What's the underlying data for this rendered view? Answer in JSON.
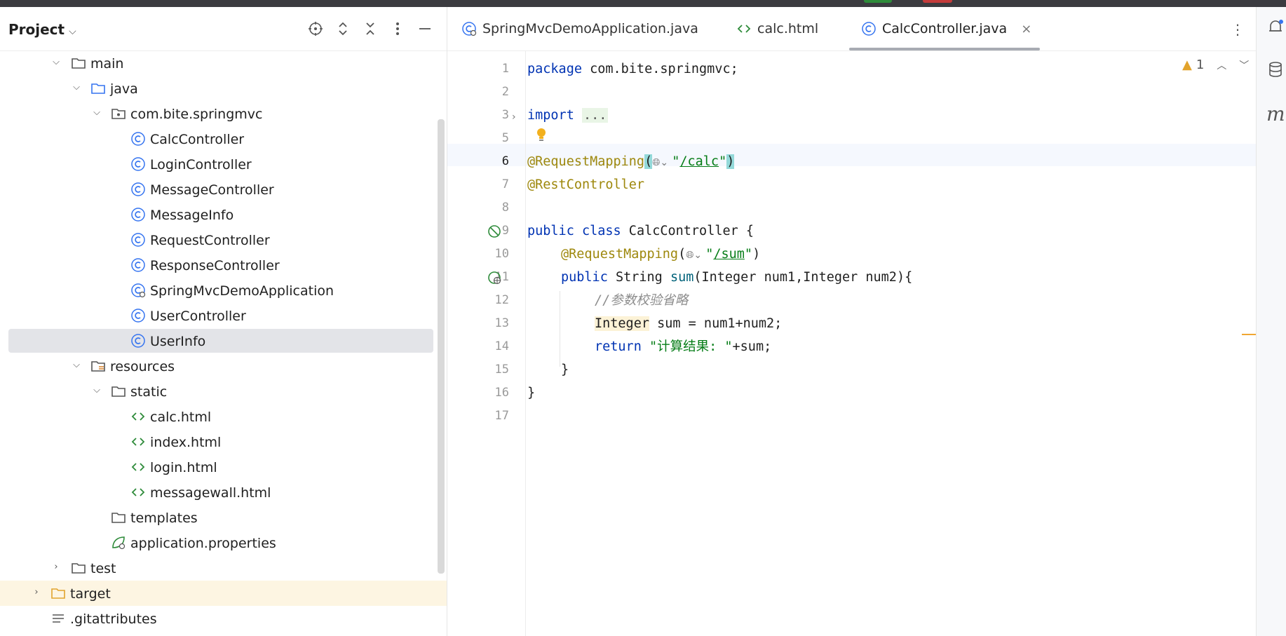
{
  "project_panel": {
    "title": "Project",
    "header_icons": [
      "locate-icon",
      "expand-all-icon",
      "collapse-all-icon",
      "more-icon",
      "minimize-icon"
    ],
    "tree": [
      {
        "label": "main",
        "type": "folder",
        "state": "expanded",
        "depth": 2
      },
      {
        "label": "java",
        "type": "source-folder",
        "state": "expanded",
        "depth": 3
      },
      {
        "label": "com.bite.springmvc",
        "type": "package",
        "state": "expanded",
        "depth": 4
      },
      {
        "label": "CalcController",
        "type": "class",
        "depth": 5
      },
      {
        "label": "LoginController",
        "type": "class",
        "depth": 5
      },
      {
        "label": "MessageController",
        "type": "class",
        "depth": 5
      },
      {
        "label": "MessageInfo",
        "type": "class",
        "depth": 5
      },
      {
        "label": "RequestController",
        "type": "class",
        "depth": 5
      },
      {
        "label": "ResponseController",
        "type": "class",
        "depth": 5
      },
      {
        "label": "SpringMvcDemoApplication",
        "type": "spring-app-class",
        "depth": 5
      },
      {
        "label": "UserController",
        "type": "class",
        "depth": 5
      },
      {
        "label": "UserInfo",
        "type": "class",
        "depth": 5,
        "selected": true
      },
      {
        "label": "resources",
        "type": "resources-folder",
        "state": "expanded",
        "depth": 3
      },
      {
        "label": "static",
        "type": "folder",
        "state": "expanded",
        "depth": 4
      },
      {
        "label": "calc.html",
        "type": "html",
        "depth": 5
      },
      {
        "label": "index.html",
        "type": "html",
        "depth": 5
      },
      {
        "label": "login.html",
        "type": "html",
        "depth": 5
      },
      {
        "label": "messagewall.html",
        "type": "html",
        "depth": 5
      },
      {
        "label": "templates",
        "type": "folder",
        "depth": 4
      },
      {
        "label": "application.properties",
        "type": "spring-properties",
        "depth": 4
      },
      {
        "label": "test",
        "type": "folder",
        "state": "collapsed",
        "depth": 2
      },
      {
        "label": "target",
        "type": "excluded-folder",
        "state": "collapsed",
        "depth": 1
      },
      {
        "label": ".gitattributes",
        "type": "text-file",
        "depth": 1
      }
    ]
  },
  "editor": {
    "tabs": [
      {
        "label": "SpringMvcDemoApplication.java",
        "icon": "spring-class-icon",
        "active": false
      },
      {
        "label": "calc.html",
        "icon": "html-icon",
        "active": false
      },
      {
        "label": "CalcController.java",
        "icon": "class-icon",
        "active": true
      }
    ],
    "close_glyph": "×",
    "warning_count": "1",
    "line_numbers": [
      "1",
      "2",
      "3",
      "5",
      "6",
      "7",
      "8",
      "9",
      "10",
      "11",
      "12",
      "13",
      "14",
      "15",
      "16",
      "17"
    ],
    "current_line": "6",
    "code": {
      "l1_kw": "package",
      "l1_rest": " com.bite.springmvc;",
      "l3_kw": "import",
      "l3_fold": "...",
      "l6_ann": "@RequestMapping",
      "l6_open": "(",
      "l6_q1": "\"",
      "l6_url": "/calc",
      "l6_q2": "\"",
      "l6_close": ")",
      "l7_ann": "@RestController",
      "l9_kw1": "public",
      "l9_kw2": "class",
      "l9_rest": " CalcController {",
      "l10_ann": "@RequestMapping",
      "l10_open": "(",
      "l10_q1": "\"",
      "l10_url": "/sum",
      "l10_q2": "\"",
      "l10_close": ")",
      "l11_kw": "public",
      "l11_type": " String ",
      "l11_fn": "sum",
      "l11_rest": "(Integer num1,Integer num2){",
      "l12_cmt": "//参数校验省略",
      "l13_type": "Integer",
      "l13_rest": " sum = num1+num2;",
      "l14_kw": "return",
      "l14_str": "\"计算结果: \"",
      "l14_rest": "+sum;",
      "l15": "}",
      "l16": "}"
    }
  },
  "colors": {
    "keyword": "#0033b3",
    "annotation": "#9e880d",
    "string": "#067d17",
    "comment": "#8c8c8c",
    "selection": "#e3e4e8"
  }
}
